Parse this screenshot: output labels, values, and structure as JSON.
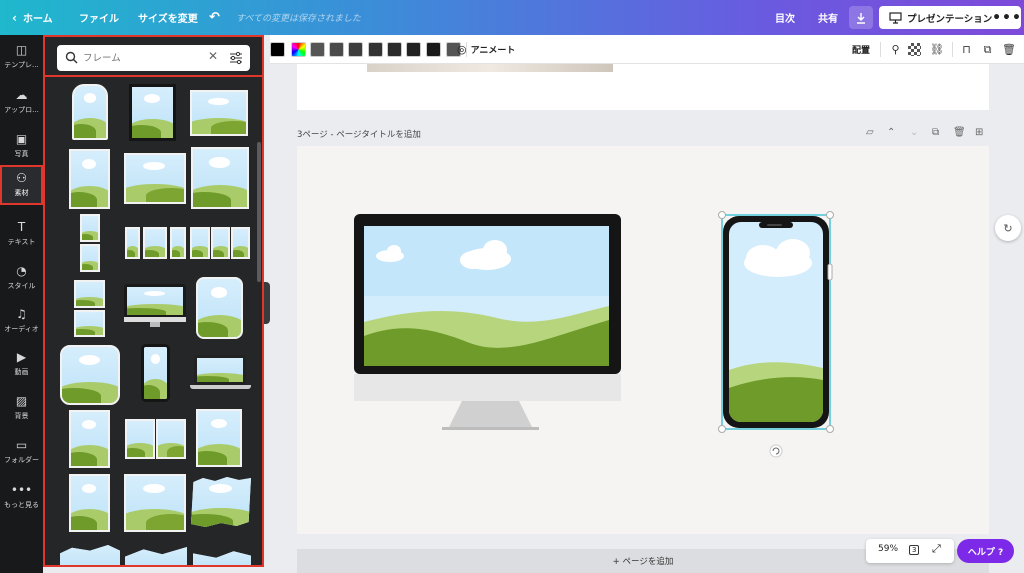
{
  "topbar": {
    "home_label": "ホーム",
    "file_label": "ファイル",
    "resize_label": "サイズを変更",
    "save_status": "すべての変更は保存されました",
    "toc_label": "目次",
    "share_label": "共有",
    "present_label": "プレゼンテーション",
    "more_label": "•••"
  },
  "rail": {
    "items": [
      {
        "label": "テンプレ...",
        "icon": "template-icon",
        "glyph": "◫"
      },
      {
        "label": "アップロ...",
        "icon": "upload-icon",
        "glyph": "☁"
      },
      {
        "label": "写真",
        "icon": "photo-icon",
        "glyph": "▣"
      },
      {
        "label": "素材",
        "icon": "elements-icon",
        "glyph": "⚇"
      },
      {
        "label": "テキスト",
        "icon": "text-icon",
        "glyph": "T"
      },
      {
        "label": "スタイル",
        "icon": "style-icon",
        "glyph": "◔"
      },
      {
        "label": "オーディオ",
        "icon": "audio-icon",
        "glyph": "♫"
      },
      {
        "label": "動画",
        "icon": "video-icon",
        "glyph": "▶"
      },
      {
        "label": "背景",
        "icon": "background-icon",
        "glyph": "▨"
      },
      {
        "label": "フォルダー",
        "icon": "folder-icon",
        "glyph": "▭"
      },
      {
        "label": "もっと見る",
        "icon": "more-icon",
        "glyph": "•••"
      }
    ]
  },
  "search": {
    "placeholder": "フレーム",
    "value": ""
  },
  "toolbar": {
    "colors": [
      "#000000",
      "rainbow",
      "#555555",
      "#4a4a4a",
      "#3d3d3d",
      "#333333",
      "#2b2b2b",
      "#222222",
      "#1a1a1a",
      "#555555"
    ],
    "animate_label": "アニメート",
    "arrange_label": "配置"
  },
  "page": {
    "title": "3ページ - ページタイトルを追加",
    "add_page_label": "+ ページを追加"
  },
  "footer": {
    "zoom": "59%",
    "page_count": "3",
    "help_label": "ヘルプ ?"
  },
  "colors": {
    "accent": "#7d2ae8",
    "highlight": "#e0362c",
    "sky": "#cde9fb",
    "hill_light": "#b6d57c",
    "hill_dark": "#6e9b2a"
  }
}
